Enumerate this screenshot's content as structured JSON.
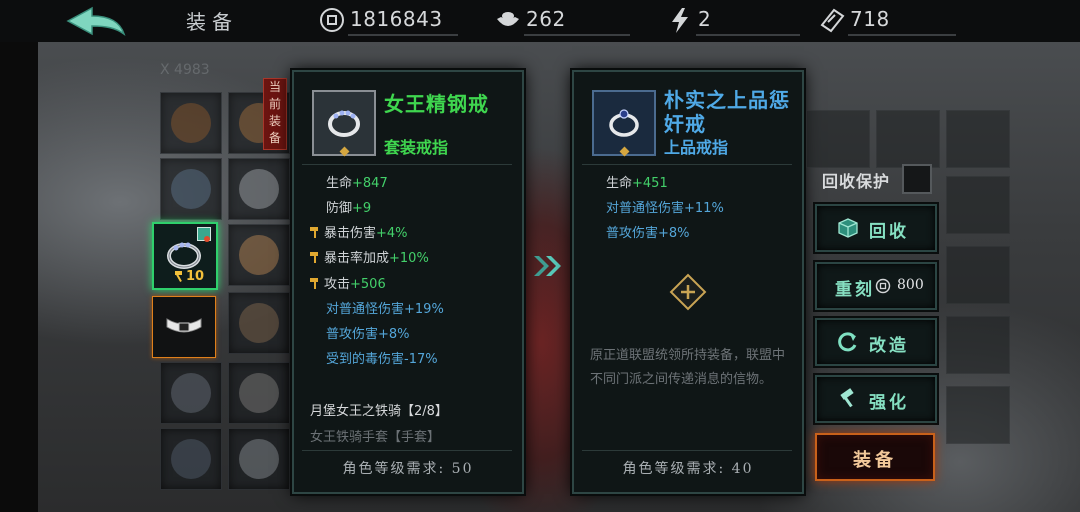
{
  "topbar": {
    "title": "装备",
    "coins": "1816843",
    "ingots": "262",
    "energy": "2",
    "tickets": "718"
  },
  "grid": {
    "header": "X 4983"
  },
  "current_tag": "当前装备",
  "equipped_level": "10",
  "left_card": {
    "name": "女王精钢戒",
    "type": "套装戒指",
    "stats": [
      {
        "name": "生命",
        "value": "+847"
      },
      {
        "name": "防御",
        "value": "+9"
      },
      {
        "name": "暴击伤害",
        "value": "+4%"
      },
      {
        "name": "暴击率加成",
        "value": "+10%"
      },
      {
        "name": "攻击",
        "value": "+506"
      },
      {
        "name": "对普通怪伤害",
        "value": "+19%"
      },
      {
        "name": "普攻伤害",
        "value": "+8%"
      },
      {
        "name": "受到的毒伤害",
        "value": "-17%"
      }
    ],
    "set_title": "月堡女王之铁骑【2/8】",
    "set_item": "女王铁骑手套【手套】",
    "req": "角色等级需求: 50",
    "name_color": "#3fd64f"
  },
  "right_card": {
    "name": "朴实之上品惩奸戒",
    "type": "上品戒指",
    "stats": [
      {
        "name": "生命",
        "value": "+451"
      },
      {
        "name": "对普通怪伤害",
        "value": "+11%"
      },
      {
        "name": "普攻伤害",
        "value": "+8%"
      }
    ],
    "desc": "原正道联盟统领所持装备，联盟中不同门派之间传递消息的信物。",
    "req": "角色等级需求: 40",
    "name_color": "#4fa9e6"
  },
  "actions": {
    "protect_label": "回收保护",
    "recycle": "回收",
    "reforge": "重刻",
    "reforge_cost": "800",
    "remake": "改造",
    "strengthen": "强化",
    "equip": "装备"
  },
  "colors": {
    "green": "#43d06a",
    "blue": "#54a6d9",
    "teal_btn": "#86e0c2",
    "orange": "#c9611a"
  }
}
